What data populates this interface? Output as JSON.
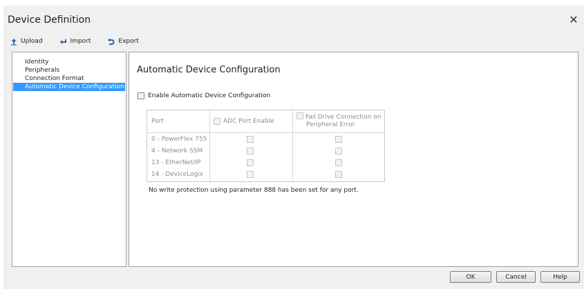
{
  "window": {
    "title": "Device Definition"
  },
  "toolbar": {
    "upload_label": "Upload",
    "import_label": "Import",
    "export_label": "Export"
  },
  "nav": {
    "items": [
      {
        "label": "Identity",
        "selected": false
      },
      {
        "label": "Peripherals",
        "selected": false
      },
      {
        "label": "Connection Format",
        "selected": false
      },
      {
        "label": "Automatic Device Configuration",
        "selected": true
      }
    ]
  },
  "content": {
    "heading": "Automatic Device Configuration",
    "enable_label": "Enable Automatic Device Configuration",
    "enable_checked": false,
    "grid": {
      "headers": {
        "port": "Port",
        "adc": "ADC Port Enable",
        "fail_line1": "Fail Drive Connection on",
        "fail_line2": "Peripheral Error"
      },
      "rows": [
        {
          "port": "0 - PowerFlex 755",
          "adc": false,
          "fail": false
        },
        {
          "port": "4 - Network SSM",
          "adc": false,
          "fail": false
        },
        {
          "port": "13 - EtherNet/IP",
          "adc": false,
          "fail": false
        },
        {
          "port": "14 - DeviceLogix",
          "adc": false,
          "fail": false
        }
      ]
    },
    "note": "No write protection using parameter 888 has been set for any port."
  },
  "buttons": {
    "ok": "OK",
    "cancel": "Cancel",
    "help": "Help"
  },
  "colors": {
    "selection": "#3399ff",
    "accent_icon": "#1e64b4",
    "panel_bg": "#f0f0f0"
  }
}
